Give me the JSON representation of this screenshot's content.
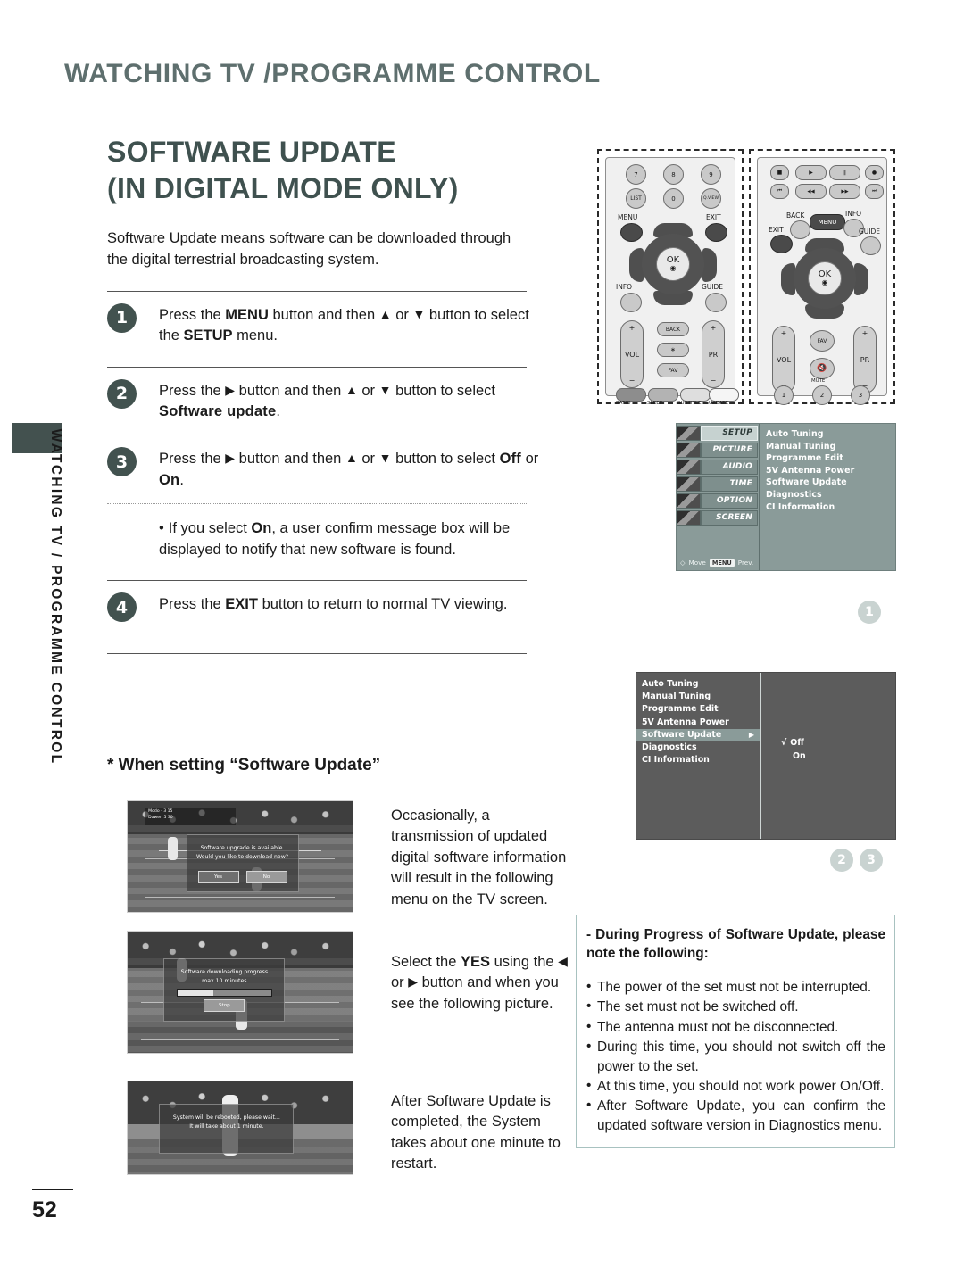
{
  "header": {
    "title": "WATCHING TV /PROGRAMME CONTROL",
    "side_tab": "WATCHING TV / PROGRAMME CONTROL"
  },
  "section": {
    "title_line1": "SOFTWARE UPDATE",
    "title_line2": "(IN DIGITAL MODE ONLY)",
    "intro": "Software Update means software can be downloaded through the digital terrestrial broadcasting system."
  },
  "steps": [
    {
      "number": "1",
      "prefix": "Press the ",
      "key1": "MENU",
      "mid1": " button and then ",
      "up": "▲",
      "or": " or ",
      "down": "▼",
      "mid2": " button to select the ",
      "key2": "SETUP",
      "suffix": " menu."
    },
    {
      "number": "2",
      "prefix": "Press the ",
      "key1": "▶",
      "mid1": " button and then ",
      "up": "▲",
      "or": " or ",
      "down": "▼",
      "mid2": " button to select ",
      "key2": "Software update",
      "suffix": "."
    },
    {
      "number": "3",
      "prefix": "Press the ",
      "key1": "▶",
      "mid1": " button and then ",
      "up": "▲",
      "or": " or ",
      "down": "▼",
      "mid2": " button to select ",
      "key2": "Off",
      "mid3": " or ",
      "key3": "On",
      "suffix": "."
    },
    {
      "number": "4",
      "prefix": "Press the ",
      "key1": "EXIT",
      "suffix": " button to return to normal TV viewing."
    }
  ],
  "note_bullet": {
    "part1": "If you select ",
    "bold": "On",
    "part2": ", a user confirm message box will be displayed to notify that new software is found."
  },
  "subheading": "* When setting “Software Update”",
  "tv_examples": [
    {
      "dialog_line1": "Software upgrade is available.",
      "dialog_line2": "Would you like to download now?",
      "button_yes": "Yes",
      "button_no": "No",
      "scorebug_line1": "Modo  - 3  15",
      "scorebug_line2": "Dawen   5  30",
      "caption": "Occasionally, a transmission of updated digital software information will result in the following menu on the TV screen."
    },
    {
      "dialog_line1": "Software downloading progress",
      "dialog_line2": "max 10 minutes",
      "button_stop": "Stop",
      "caption_pre": "Select the ",
      "caption_bold": "YES",
      "caption_mid": " using the ",
      "caption_left": "◀",
      "caption_or": " or ",
      "caption_right": "▶",
      "caption_post": " button and when you see the following picture."
    },
    {
      "dialog_line1": "System will be rebooted, please wait...",
      "dialog_line2": "It will take about 1 minute.",
      "caption": "After Software Update is completed, the System takes about one minute to restart."
    }
  ],
  "remote_left": {
    "numbers_row1": [
      "7",
      "8",
      "9"
    ],
    "numbers_row2": [
      "LIST",
      "0",
      "Q.VIEW"
    ],
    "menu_label": "MENU",
    "exit_label": "EXIT",
    "info_label": "INFO",
    "guide_label": "GUIDE",
    "ok_label": "OK",
    "vol_label": "VOL",
    "pr_label": "PR",
    "back_label": "BACK",
    "fav_label": "FAV",
    "star_label": "∗",
    "plus": "+",
    "minus": "−",
    "bottom_labels": [
      "RATIO",
      "SLEEP",
      "SUBTITLE",
      "UPDATE"
    ]
  },
  "remote_right": {
    "transport_row1": [
      "■",
      "▶",
      "‖",
      "●"
    ],
    "transport_row2": [
      "⏮",
      "◀◀",
      "▶▶",
      "⏭"
    ],
    "back_label": "BACK",
    "menu_label": "MENU",
    "info_label": "INFO",
    "exit_label": "EXIT",
    "guide_label": "GUIDE",
    "ok_label": "OK",
    "vol_label": "VOL",
    "pr_label": "PR",
    "fav_label": "FAV",
    "mute_label": "MUTE",
    "plus": "+",
    "minus": "−",
    "number_buttons": [
      "1",
      "2",
      "3"
    ]
  },
  "osd_menu_1": {
    "tabs": [
      {
        "label": "SETUP",
        "active": true
      },
      {
        "label": "PICTURE",
        "active": false
      },
      {
        "label": "AUDIO",
        "active": false
      },
      {
        "label": "TIME",
        "active": false
      },
      {
        "label": "OPTION",
        "active": false
      },
      {
        "label": "SCREEN",
        "active": false
      }
    ],
    "items": [
      "Auto Tuning",
      "Manual Tuning",
      "Programme Edit",
      "5V Antenna Power",
      "Software Update",
      "Diagnostics",
      "CI Information"
    ],
    "footer_move": "Move",
    "footer_key": "MENU",
    "footer_prev": "Prev.",
    "marker": "1"
  },
  "osd_menu_2": {
    "items": [
      {
        "label": "Auto Tuning",
        "selected": false
      },
      {
        "label": "Manual Tuning",
        "selected": false
      },
      {
        "label": "Programme Edit",
        "selected": false
      },
      {
        "label": "5V Antenna Power",
        "selected": false
      },
      {
        "label": "Software Update",
        "selected": true,
        "caret": "▶"
      },
      {
        "label": "Diagnostics",
        "selected": false
      },
      {
        "label": "CI Information",
        "selected": false
      }
    ],
    "options": [
      {
        "label": "Off",
        "checked": true,
        "check": "√"
      },
      {
        "label": "On",
        "checked": false
      }
    ],
    "markers": [
      "2",
      "3"
    ]
  },
  "notice": {
    "title": "- During Progress of Software Update, please note the following:",
    "items": [
      "The power of the set must not be interrupted.",
      "The set must not be switched off.",
      "The antenna must not be disconnected.",
      "During this time, you should not switch off the power to the set.",
      "At this time, you should not work power On/Off.",
      "After Software Update, you can confirm the updated software version in Diagnostics menu."
    ]
  },
  "footer": {
    "page_number": "52"
  },
  "colors": {
    "header_text": "#5e6f6e",
    "title_text": "#3f514f",
    "step_circle": "#42524f",
    "osd_teal": "#8a9b99",
    "osd_gray": "#5c5c5c",
    "notice_border": "#a8c2c0",
    "marker_gray": "#c9d3d1"
  }
}
